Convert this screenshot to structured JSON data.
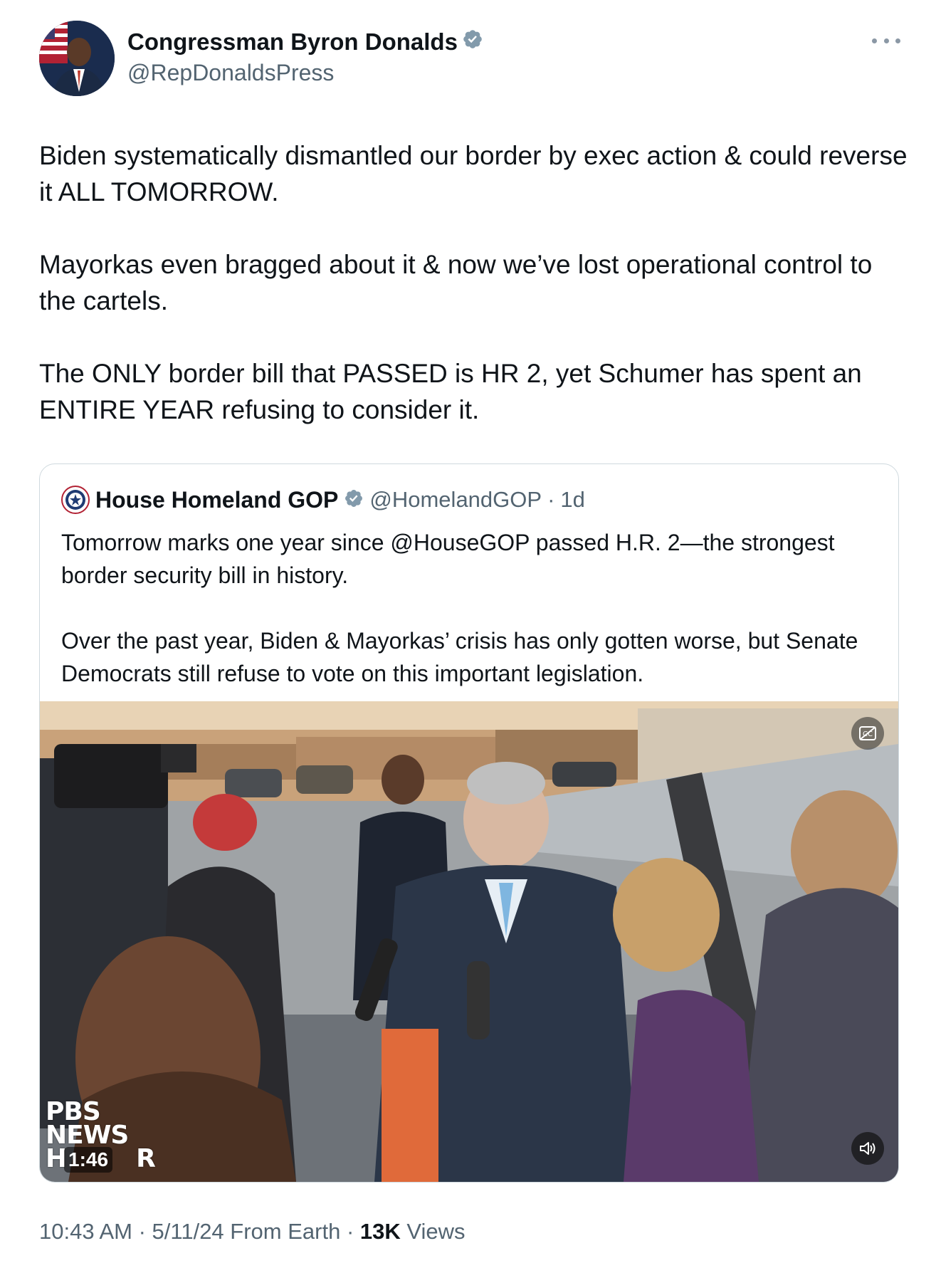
{
  "author": {
    "name": "Congressman Byron Donalds",
    "handle": "@RepDonaldsPress",
    "verified_color": "#829aab"
  },
  "tweet": {
    "paragraphs": [
      "Biden systematically dismantled our border by exec action & could reverse it ALL TOMORROW.",
      "Mayorkas even bragged about it & now we’ve lost operational control to the cartels.",
      "The ONLY border bill that PASSED is HR 2, yet Schumer has spent an ENTIRE YEAR refusing to consider it."
    ]
  },
  "quoted": {
    "name": "House Homeland GOP",
    "handle": "@HomelandGOP",
    "separator": "·",
    "age": "1d",
    "paragraphs": [
      "Tomorrow marks one year since @HouseGOP passed H.R. 2—the strongest border security bill in history.",
      "Over the past year, Biden & Mayorkas’ crisis has only gotten worse, but Senate Democrats still refuse to vote on this important legislation."
    ],
    "video": {
      "logo_line1": "PBS",
      "logo_line2": "NEWS",
      "logo_line3": "H",
      "logo_line3_end": "R",
      "duration": "1:46"
    }
  },
  "meta": {
    "time": "10:43 AM",
    "sep1": " · ",
    "date": "5/11/24",
    "source": " From Earth",
    "sep2": " · ",
    "views_count": "13K",
    "views_label": " Views"
  },
  "icons": {
    "verified": "verified-badge-icon",
    "more": "more-icon",
    "captions": "captions-icon",
    "volume": "volume-icon"
  }
}
